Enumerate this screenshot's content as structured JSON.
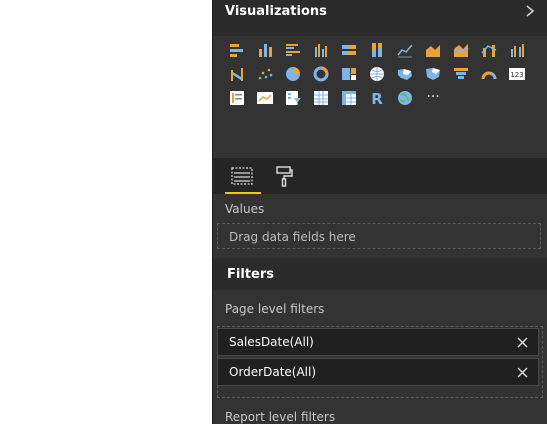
{
  "visualizations": {
    "title": "Visualizations",
    "icons": [
      [
        "stacked-bar-chart-icon",
        "stacked-column-chart-icon",
        "clustered-bar-chart-icon",
        "clustered-column-chart-icon",
        "100-percent-stacked-bar-chart-icon",
        "100-percent-stacked-column-chart-icon",
        "line-chart-icon",
        "area-chart-icon",
        "stacked-area-chart-icon",
        "line-and-stacked-column-chart-icon",
        "line-and-clustered-column-chart-icon"
      ],
      [
        "ribbon-chart-icon",
        "scatter-chart-icon",
        "pie-chart-icon",
        "donut-chart-icon",
        "treemap-icon",
        "map-icon",
        "filled-map-icon",
        "shape-map-icon",
        "funnel-icon",
        "gauge-icon",
        "card-icon"
      ],
      [
        "multi-row-card-icon",
        "kpi-icon",
        "slicer-icon",
        "table-icon",
        "matrix-icon",
        "r-visual-icon",
        "globe-map-icon",
        "more-visuals-icon"
      ]
    ],
    "card_label": "123",
    "r_label": "R",
    "more_label": "···"
  },
  "wells": {
    "values_label": "Values",
    "dropzone_text": "Drag data fields here"
  },
  "filters": {
    "title": "Filters",
    "page_level_label": "Page level filters",
    "items": [
      {
        "label": "SalesDate(All)"
      },
      {
        "label": "OrderDate(All)"
      }
    ],
    "report_level_label": "Report level filters"
  },
  "colors": {
    "pane_bg": "#333333",
    "header_bg": "#2b2b2b",
    "accent_yellow": "#f2c811",
    "icon_orange": "#e8a33d",
    "icon_blue": "#7fb5e6"
  }
}
